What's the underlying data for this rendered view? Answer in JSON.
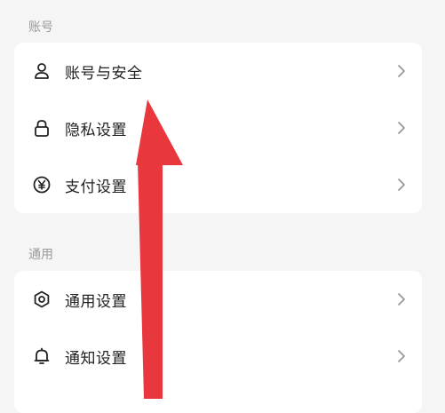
{
  "sections": {
    "account": {
      "title": "账号",
      "items": [
        {
          "label": "账号与安全",
          "icon": "person-icon"
        },
        {
          "label": "隐私设置",
          "icon": "lock-icon"
        },
        {
          "label": "支付设置",
          "icon": "yen-icon"
        }
      ]
    },
    "general": {
      "title": "通用",
      "items": [
        {
          "label": "通用设置",
          "icon": "gear-icon"
        },
        {
          "label": "通知设置",
          "icon": "bell-icon"
        }
      ]
    }
  },
  "colors": {
    "background": "#f5f5f5",
    "card": "#ffffff",
    "text": "#222222",
    "section_title": "#9a9a9a",
    "chevron": "#999999",
    "annotation_arrow": "#e8383d"
  }
}
